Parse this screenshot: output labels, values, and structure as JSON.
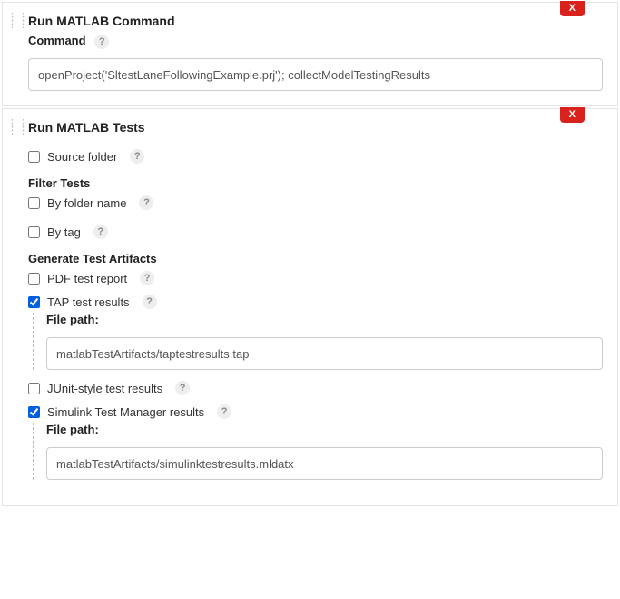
{
  "block1": {
    "title": "Run MATLAB Command",
    "delete": "X",
    "command_label": "Command",
    "command_value": "openProject('SltestLaneFollowingExample.prj'); collectModelTestingResults"
  },
  "block2": {
    "title": "Run MATLAB Tests",
    "delete": "X",
    "source_label": "Source folder",
    "filter_head": "Filter Tests",
    "byfolder_label": "By folder name",
    "bytag_label": "By tag",
    "artifacts_head": "Generate Test Artifacts",
    "pdf_label": "PDF test report",
    "tap_label": "TAP test results",
    "tap_path_label": "File path:",
    "tap_path_value": "matlabTestArtifacts/taptestresults.tap",
    "junit_label": "JUnit-style test results",
    "sl_label": "Simulink Test Manager results",
    "sl_path_label": "File path:",
    "sl_path_value": "matlabTestArtifacts/simulinktestresults.mldatx"
  }
}
